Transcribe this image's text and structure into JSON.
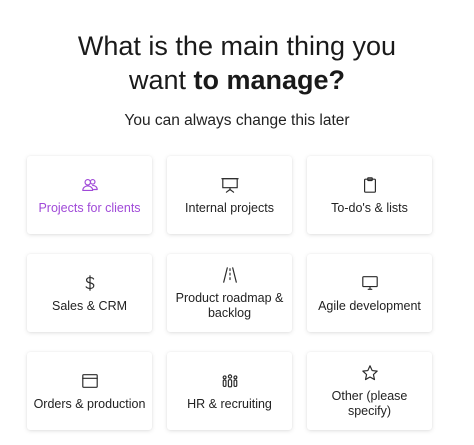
{
  "header": {
    "title_line1": "What is the main thing you",
    "title_line2_prefix": "want ",
    "title_line2_bold": "to manage?",
    "subtitle": "You can always change this later"
  },
  "accent_color": "#a04ad8",
  "options": [
    {
      "label": "Projects for clients",
      "icon": "people-icon",
      "selected": true
    },
    {
      "label": "Internal projects",
      "icon": "presentation-board-icon",
      "selected": false
    },
    {
      "label": "To-do's & lists",
      "icon": "clipboard-icon",
      "selected": false
    },
    {
      "label": "Sales & CRM",
      "icon": "dollar-icon",
      "selected": false
    },
    {
      "label": "Product roadmap & backlog",
      "icon": "roadmap-icon",
      "selected": false
    },
    {
      "label": "Agile development",
      "icon": "monitor-icon",
      "selected": false
    },
    {
      "label": "Orders & production",
      "icon": "box-icon",
      "selected": false
    },
    {
      "label": "HR & recruiting",
      "icon": "team-icon",
      "selected": false
    },
    {
      "label": "Other (please specify)",
      "icon": "star-icon",
      "selected": false
    }
  ]
}
